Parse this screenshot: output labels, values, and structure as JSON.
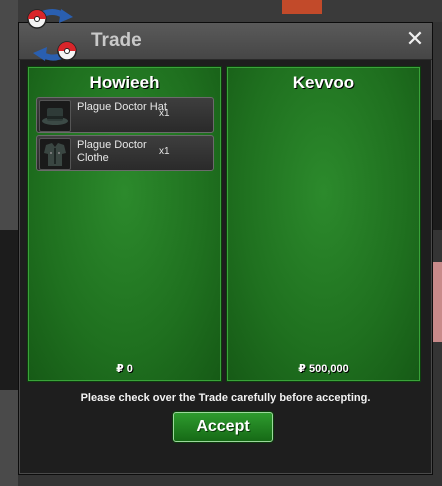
{
  "window": {
    "title": "Trade",
    "close_label": "✕"
  },
  "trade": {
    "left": {
      "player": "Howieeh",
      "money": "₽ 0",
      "items": [
        {
          "name": "Plague Doctor Hat",
          "qty": "x1",
          "icon": "hat-icon"
        },
        {
          "name": "Plague Doctor Clothe",
          "qty": "x1",
          "icon": "clothes-icon"
        }
      ]
    },
    "right": {
      "player": "Kevvoo",
      "money": "₽ 500,000",
      "items": []
    }
  },
  "footer": {
    "message": "Please check over the Trade carefully before accepting.",
    "accept_label": "Accept"
  },
  "colors": {
    "panel_green": "#1f701f",
    "accept_green": "#2e9b2e",
    "titlebar": "#4e4e4e"
  }
}
